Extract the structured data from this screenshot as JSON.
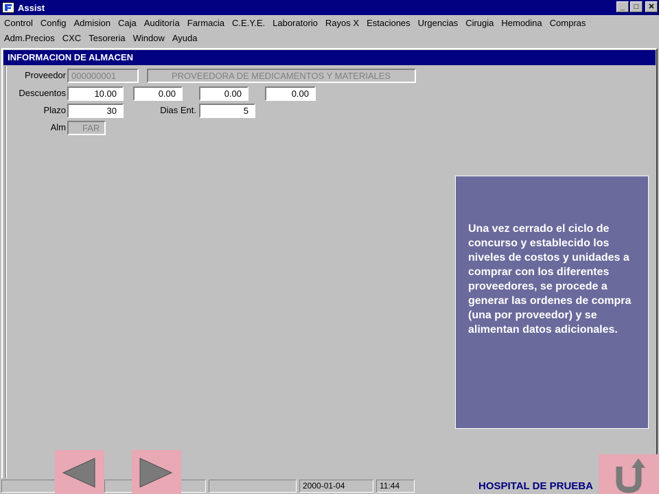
{
  "window": {
    "title": "Assist",
    "minimize": "_",
    "maximize": "□",
    "close": "✕"
  },
  "menu": {
    "row1": [
      "Control",
      "Config",
      "Admision",
      "Caja",
      "Auditoría",
      "Farmacia",
      "C.E.Y.E.",
      "Laboratorio",
      "Rayos X",
      "Estaciones",
      "Urgencias",
      "Cirugia",
      "Hemodina",
      "Compras"
    ],
    "row2": [
      "Adm.Precios",
      "CXC",
      "Tesoreria",
      "Window",
      "Ayuda"
    ]
  },
  "form": {
    "title": "INFORMACION DE ALMACEN",
    "proveedor_label": "Proveedor",
    "proveedor_code": "000000001",
    "proveedor_name": "PROVEEDORA DE MEDICAMENTOS Y MATERIALES",
    "descuentos_label": "Descuentos",
    "descuentos": [
      "10.00",
      "0.00",
      "0.00",
      "0.00"
    ],
    "plazo_label": "Plazo",
    "plazo": "30",
    "dias_label": "Dias Ent.",
    "dias": "5",
    "alm_label": "Alm",
    "alm": "FAR"
  },
  "callout": {
    "text": "Una vez cerrado el ciclo de concurso y establecido los niveles de costos y unidades a comprar con los diferentes proveedores, se procede a generar las ordenes de compra (una por proveedor) y se alimentan datos adicionales."
  },
  "status": {
    "date": "2000-01-04",
    "time": "11:44",
    "hospital": "HOSPITAL DE PRUEBA"
  },
  "colors": {
    "titlebar": "#000080",
    "callout": "#6a6a9c",
    "nav_button": "#e8a8b4"
  },
  "icons": {
    "prev": "triangle-left-icon",
    "next": "triangle-right-icon",
    "home": "return-arrow-icon"
  }
}
